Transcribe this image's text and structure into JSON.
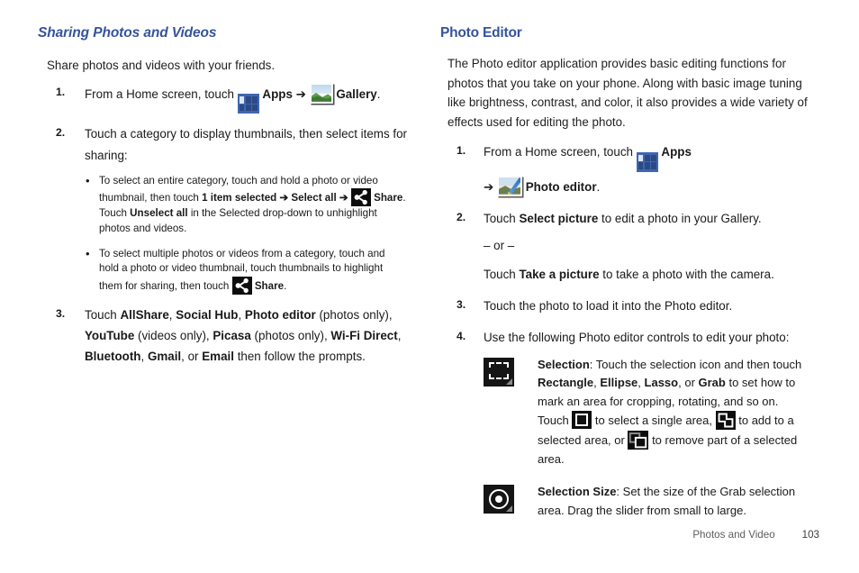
{
  "left_column": {
    "heading": "Sharing Photos and Videos",
    "intro": "Share photos and videos with your friends.",
    "steps": [
      {
        "num": "1.",
        "seg_a": "From a Home screen, touch ",
        "apps_label": "Apps",
        "arrow": " ➔ ",
        "gallery_label": "Gallery",
        "seg_end": "."
      },
      {
        "num": "2.",
        "text": "Touch a category to display thumbnails, then select items for sharing:",
        "bullets": [
          {
            "b1": "To select an entire category, touch and hold a photo or video thumbnail, then touch ",
            "bold1": "1 item selected",
            "arrow1": " ➔ ",
            "bold2": "Select all",
            "arrow2": " ➔ ",
            "bold3": "Share",
            "b2": ". Touch ",
            "bold4": "Unselect all",
            "b3": " in the Selected drop-down to unhighlight photos and videos."
          },
          {
            "b1": "To select multiple photos or videos from a category, touch and hold a photo or video thumbnail, touch thumbnails to highlight them for sharing, then touch ",
            "bold1": "Share",
            "b2": "."
          }
        ]
      },
      {
        "num": "3.",
        "t1": "Touch ",
        "b1": "AllShare",
        "t2": ", ",
        "b2": "Social Hub",
        "t3": ", ",
        "b3": "Photo editor",
        "t4": " (photos only), ",
        "b4": "YouTube",
        "t5": " (videos only), ",
        "b5": "Picasa",
        "t6": " (photos only), ",
        "b6": "Wi-Fi Direct",
        "t7": ", ",
        "b7": "Bluetooth",
        "t8": ", ",
        "b8": "Gmail",
        "t9": ", or ",
        "b9": "Email",
        "t10": " then follow the prompts."
      }
    ]
  },
  "right_column": {
    "heading": "Photo Editor",
    "intro": "The Photo editor application provides basic editing functions for photos that you take on your phone. Along with basic image tuning like brightness, contrast, and color, it also provides a wide variety of effects used for editing the photo.",
    "steps": [
      {
        "num": "1.",
        "seg_a": "From a Home screen, touch ",
        "apps_label": "Apps",
        "arrow": "➔ ",
        "photo_editor_label": "Photo editor",
        "seg_end": "."
      },
      {
        "num": "2.",
        "t1": "Touch ",
        "b1": "Select picture",
        "t2": " to edit a photo in your Gallery.",
        "or_line": "– or –",
        "t3": "Touch ",
        "b2": "Take a picture",
        "t4": " to take a photo with the camera."
      },
      {
        "num": "3.",
        "text": "Touch the photo to load it into the Photo editor."
      },
      {
        "num": "4.",
        "text": "Use the following Photo editor controls to edit your photo:",
        "controls": [
          {
            "icon": "selection-icon",
            "title": "Selection",
            "t1": ": Touch the selection icon and then touch ",
            "b1": "Rectangle",
            "t2": ", ",
            "b2": "Ellipse",
            "t3": ", ",
            "b3": "Lasso",
            "t4": ", or ",
            "b4": "Grab",
            "t5": " to set how to mark an area for cropping, rotating, and so on. Touch ",
            "t6": " to select a single area, ",
            "t7": " to add to a selected area, or ",
            "t8": " to remove part of a selected area."
          },
          {
            "icon": "selection-size-icon",
            "title": "Selection Size",
            "t1": ": Set the size of the Grab selection area. Drag the slider from small to large."
          }
        ]
      }
    ]
  },
  "footer": {
    "chapter": "Photos and Video",
    "page_number": "103"
  },
  "colors": {
    "heading": "#36539c",
    "body_text": "#1f1f1f",
    "footer_text": "#5d5d5d",
    "apps_icon_bg": "#3f66b0",
    "icon_tile_bg": "#0d0d0d"
  }
}
